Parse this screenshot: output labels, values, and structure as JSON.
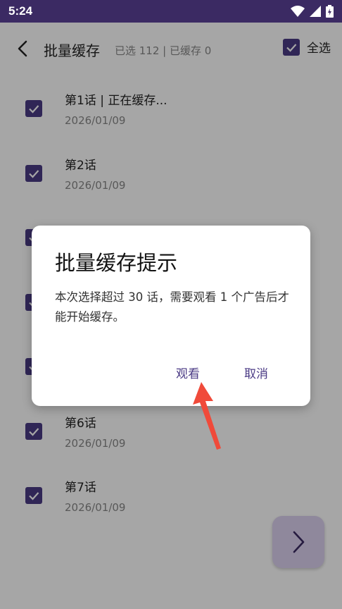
{
  "status_bar": {
    "time": "5:24"
  },
  "header": {
    "title": "批量缓存",
    "subtitle": "已选 112 | 已缓存 0",
    "select_all_label": "全选"
  },
  "episodes": [
    {
      "name": "第1话 | 正在缓存...",
      "date": "2026/01/09"
    },
    {
      "name": "第2话",
      "date": "2026/01/09"
    },
    {
      "name": "",
      "date": ""
    },
    {
      "name": "",
      "date": ""
    },
    {
      "name": "",
      "date": ""
    },
    {
      "name": "第6话",
      "date": "2026/01/09"
    },
    {
      "name": "第7话",
      "date": "2026/01/09"
    }
  ],
  "dialog": {
    "title": "批量缓存提示",
    "message": "本次选择超过 30 话，需要观看 1 个广告后才能开始缓存。",
    "watch_label": "观看",
    "cancel_label": "取消"
  },
  "colors": {
    "accent": "#4b3b85",
    "status_bar": "#3b2a63",
    "annotation_arrow": "#f04a3a"
  }
}
